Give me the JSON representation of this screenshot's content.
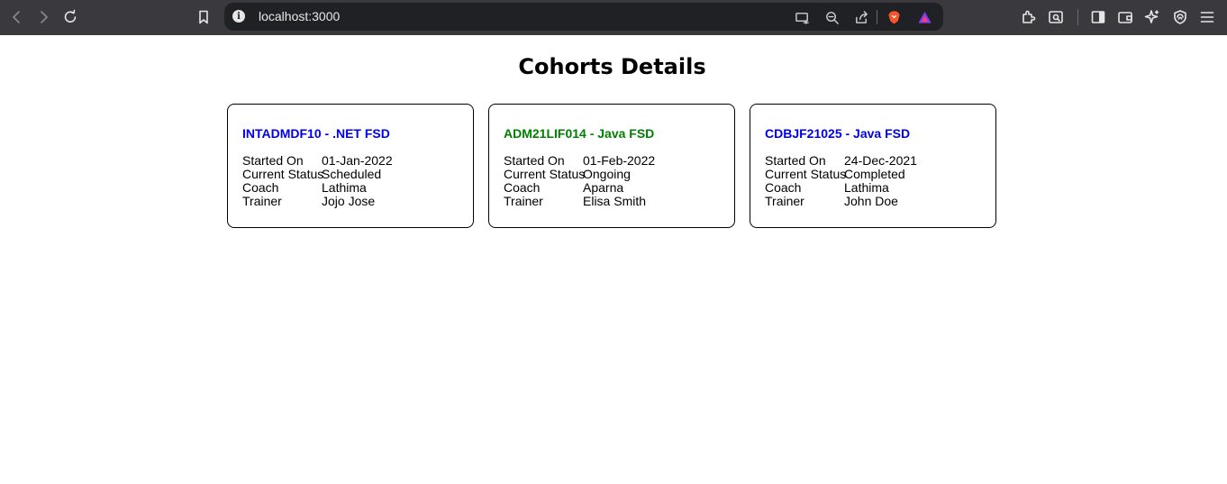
{
  "browser": {
    "url": "localhost:3000"
  },
  "page": {
    "title": "Cohorts Details"
  },
  "colors": {
    "scheduled_title": "#0000ee",
    "ongoing_title": "#008000",
    "completed_title": "#0000ee",
    "browser_toolbar": "#3a3a3e",
    "url_bar": "#202124"
  },
  "cohorts": [
    {
      "title": "INTADMDF10 - .NET FSD",
      "color": "#0000ee",
      "labels": [
        "Started On",
        "Current Status",
        "Coach",
        "Trainer"
      ],
      "values": [
        "01-Jan-2022",
        "Scheduled",
        "Lathima",
        "Jojo Jose"
      ]
    },
    {
      "title": "ADM21LIF014 - Java FSD",
      "color": "#008000",
      "labels": [
        "Started On",
        "Current Status",
        "Coach",
        "Trainer"
      ],
      "values": [
        "01-Feb-2022",
        "Ongoing",
        "Aparna",
        "Elisa Smith"
      ]
    },
    {
      "title": "CDBJF21025 - Java FSD",
      "color": "#0000ee",
      "labels": [
        "Started On",
        "Current Status",
        "Coach",
        "Trainer"
      ],
      "values": [
        "24-Dec-2021",
        "Completed",
        "Lathima",
        "John Doe"
      ]
    }
  ]
}
